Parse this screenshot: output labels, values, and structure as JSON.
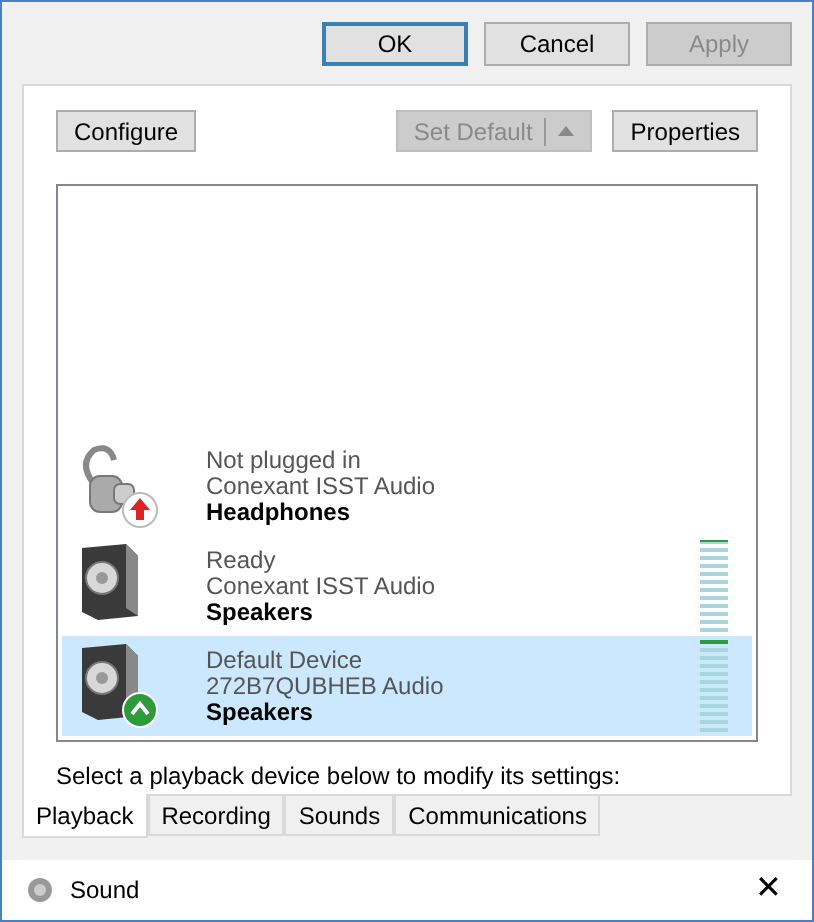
{
  "dialog_buttons": [
    {
      "label": "OK",
      "disabled": false,
      "default": true
    },
    {
      "label": "Cancel",
      "disabled": false,
      "default": false
    },
    {
      "label": "Apply",
      "disabled": true,
      "default": false
    }
  ],
  "panel_buttons": [
    {
      "label": "Configure",
      "disabled": false,
      "split": false
    },
    {
      "label": "Set Default",
      "disabled": true,
      "split": true
    },
    {
      "label": "Properties",
      "disabled": false,
      "split": false
    }
  ],
  "devices": [
    {
      "status": "Not plugged in",
      "driver": "Conexant ISST Audio",
      "name": "Headphones",
      "kind": "headphones",
      "default": false,
      "unplugged": true,
      "selected": false
    },
    {
      "status": "Ready",
      "driver": "Conexant ISST Audio",
      "name": "Speakers",
      "kind": "speaker",
      "default": false,
      "unplugged": false,
      "selected": false,
      "level": 0
    },
    {
      "status": "Default Device",
      "driver": "272B7QUBHEB Audio",
      "name": "Speakers",
      "kind": "speaker",
      "default": true,
      "unplugged": false,
      "selected": true,
      "level": 0.08
    }
  ],
  "instruction": "Select a playback device below to modify its settings:",
  "tabs": [
    {
      "label": "Playback",
      "selected": true
    },
    {
      "label": "Recording",
      "selected": false
    },
    {
      "label": "Sounds",
      "selected": false
    },
    {
      "label": "Communications",
      "selected": false
    }
  ],
  "window": {
    "title": "Sound",
    "close": "✕"
  }
}
